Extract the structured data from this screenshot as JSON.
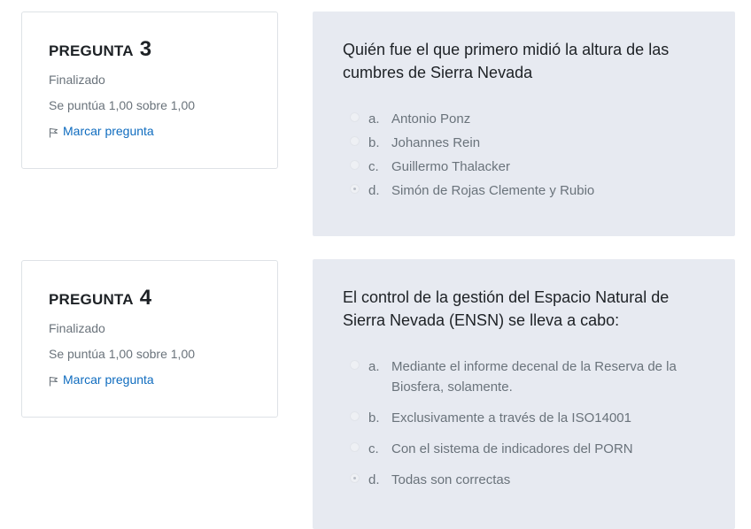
{
  "questions": [
    {
      "label": "PREGUNTA",
      "number": "3",
      "state": "Finalizado",
      "grade": "Se puntúa 1,00 sobre 1,00",
      "flag_label": "Marcar pregunta",
      "text": "Quién fue el que primero midió la altura de las cumbres de Sierra Nevada",
      "answers": [
        {
          "letter": "a.",
          "text": "Antonio Ponz",
          "selected": false
        },
        {
          "letter": "b.",
          "text": "Johannes Rein",
          "selected": false
        },
        {
          "letter": "c.",
          "text": "Guillermo Thalacker",
          "selected": false
        },
        {
          "letter": "d.",
          "text": "Simón de Rojas Clemente y Rubio",
          "selected": true
        }
      ]
    },
    {
      "label": "PREGUNTA",
      "number": "4",
      "state": "Finalizado",
      "grade": "Se puntúa 1,00 sobre 1,00",
      "flag_label": "Marcar pregunta",
      "text": "El control de la gestión del Espacio Natural de Sierra Nevada (ENSN) se lleva a cabo:",
      "answers": [
        {
          "letter": "a.",
          "text": "Mediante el informe decenal de la Reserva de la Biosfera, solamente.",
          "selected": false
        },
        {
          "letter": "b.",
          "text": "Exclusivamente a través de la ISO14001",
          "selected": false
        },
        {
          "letter": "c.",
          "text": "Con el sistema de indicadores del PORN",
          "selected": false
        },
        {
          "letter": "d.",
          "text": "Todas son correctas",
          "selected": true
        }
      ]
    }
  ]
}
